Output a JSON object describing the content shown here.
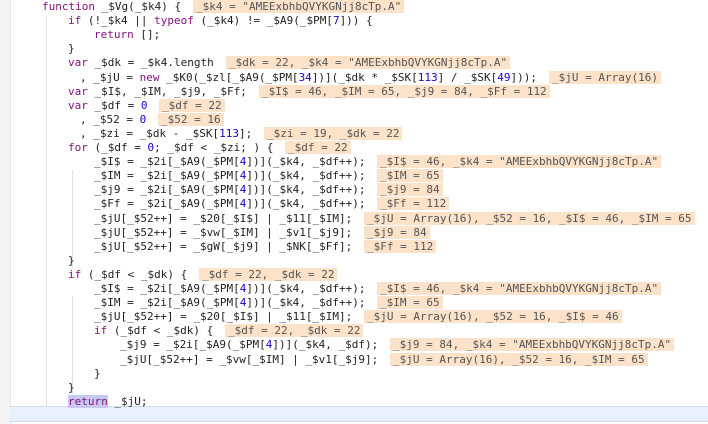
{
  "editor": {
    "lines": [
      {
        "indent": 42,
        "code": [
          {
            "k": "kw",
            "t": "function"
          },
          {
            "k": "id",
            "t": " _$Vg(_$k4) {"
          }
        ],
        "ann": "_$k4 = \"AMEExbhbQVYKGNjj8cTp.A\""
      },
      {
        "indent": 68,
        "code": [
          {
            "k": "kw",
            "t": "if"
          },
          {
            "k": "id",
            "t": " (!_$k4 || "
          },
          {
            "k": "kw",
            "t": "typeof"
          },
          {
            "k": "id",
            "t": " (_$k4) != _$A9(_$PM["
          },
          {
            "k": "num",
            "t": "7"
          },
          {
            "k": "id",
            "t": "])) {"
          }
        ],
        "ann": ""
      },
      {
        "indent": 94,
        "code": [
          {
            "k": "kw",
            "t": "return"
          },
          {
            "k": "id",
            "t": " [];"
          }
        ],
        "ann": ""
      },
      {
        "indent": 68,
        "code": [
          {
            "k": "id",
            "t": "}"
          }
        ],
        "ann": ""
      },
      {
        "indent": 68,
        "code": [
          {
            "k": "kw",
            "t": "var"
          },
          {
            "k": "id",
            "t": " _$dk = _$k4.length"
          }
        ],
        "ann": "_$dk = 22, _$k4 = \"AMEExbhbQVYKGNjj8cTp.A\""
      },
      {
        "indent": 80,
        "code": [
          {
            "k": "id",
            "t": ", _$jU = "
          },
          {
            "k": "kw",
            "t": "new"
          },
          {
            "k": "id",
            "t": " _$K0(_$zl[_$A9(_$PM["
          },
          {
            "k": "num",
            "t": "34"
          },
          {
            "k": "id",
            "t": "])](_$dk * _$SK["
          },
          {
            "k": "num",
            "t": "113"
          },
          {
            "k": "id",
            "t": "] / _$SK["
          },
          {
            "k": "num",
            "t": "49"
          },
          {
            "k": "id",
            "t": "]));"
          }
        ],
        "ann": "_$jU = Array(16)"
      },
      {
        "indent": 68,
        "code": [
          {
            "k": "kw",
            "t": "var"
          },
          {
            "k": "id",
            "t": " _$I$, _$IM, _$j9, _$Ff;"
          }
        ],
        "ann": "_$I$ = 46, _$IM = 65, _$j9 = 84, _$Ff = 112"
      },
      {
        "indent": 68,
        "code": [
          {
            "k": "kw",
            "t": "var"
          },
          {
            "k": "id",
            "t": " _$df = "
          },
          {
            "k": "num",
            "t": "0"
          }
        ],
        "ann": "_$df = 22"
      },
      {
        "indent": 80,
        "code": [
          {
            "k": "id",
            "t": ", _$52 = "
          },
          {
            "k": "num",
            "t": "0"
          }
        ],
        "ann": "_$52 = 16"
      },
      {
        "indent": 80,
        "code": [
          {
            "k": "id",
            "t": ", _$zi = _$dk - _$SK["
          },
          {
            "k": "num",
            "t": "113"
          },
          {
            "k": "id",
            "t": "];"
          }
        ],
        "ann": "_$zi = 19, _$dk = 22"
      },
      {
        "indent": 68,
        "code": [
          {
            "k": "kw",
            "t": "for"
          },
          {
            "k": "id",
            "t": " (_$df = "
          },
          {
            "k": "num",
            "t": "0"
          },
          {
            "k": "id",
            "t": "; _$df < _$zi; ) {"
          }
        ],
        "ann": "_$df = 22"
      },
      {
        "indent": 94,
        "code": [
          {
            "k": "id",
            "t": "_$I$ = _$2i[_$A9(_$PM["
          },
          {
            "k": "num",
            "t": "4"
          },
          {
            "k": "id",
            "t": "])](_$k4, _$df++);"
          }
        ],
        "ann": "_$I$ = 46, _$k4 = \"AMEExbhbQVYKGNjj8cTp.A\""
      },
      {
        "indent": 94,
        "code": [
          {
            "k": "id",
            "t": "_$IM = _$2i[_$A9(_$PM["
          },
          {
            "k": "num",
            "t": "4"
          },
          {
            "k": "id",
            "t": "])](_$k4, _$df++);"
          }
        ],
        "ann": "_$IM = 65"
      },
      {
        "indent": 94,
        "code": [
          {
            "k": "id",
            "t": "_$j9 = _$2i[_$A9(_$PM["
          },
          {
            "k": "num",
            "t": "4"
          },
          {
            "k": "id",
            "t": "])](_$k4, _$df++);"
          }
        ],
        "ann": "_$j9 = 84"
      },
      {
        "indent": 94,
        "code": [
          {
            "k": "id",
            "t": "_$Ff = _$2i[_$A9(_$PM["
          },
          {
            "k": "num",
            "t": "4"
          },
          {
            "k": "id",
            "t": "])](_$k4, _$df++);"
          }
        ],
        "ann": "_$Ff = 112"
      },
      {
        "indent": 94,
        "code": [
          {
            "k": "id",
            "t": "_$jU[_$52++] = _$20[_$I$] | _$11[_$IM];"
          }
        ],
        "ann": "_$jU = Array(16), _$52 = 16, _$I$ = 46, _$IM = 65"
      },
      {
        "indent": 94,
        "code": [
          {
            "k": "id",
            "t": "_$jU[_$52++] = _$vw[_$IM] | _$v1[_$j9];"
          }
        ],
        "ann": "_$j9 = 84"
      },
      {
        "indent": 94,
        "code": [
          {
            "k": "id",
            "t": "_$jU[_$52++] = _$gW[_$j9] | _$NK[_$Ff];"
          }
        ],
        "ann": "_$Ff = 112"
      },
      {
        "indent": 68,
        "code": [
          {
            "k": "id",
            "t": "}"
          }
        ],
        "ann": ""
      },
      {
        "indent": 68,
        "code": [
          {
            "k": "kw",
            "t": "if"
          },
          {
            "k": "id",
            "t": " (_$df < _$dk) {"
          }
        ],
        "ann": "_$df = 22, _$dk = 22"
      },
      {
        "indent": 94,
        "code": [
          {
            "k": "id",
            "t": "_$I$ = _$2i[_$A9(_$PM["
          },
          {
            "k": "num",
            "t": "4"
          },
          {
            "k": "id",
            "t": "])](_$k4, _$df++);"
          }
        ],
        "ann": "_$I$ = 46, _$k4 = \"AMEExbhbQVYKGNjj8cTp.A\""
      },
      {
        "indent": 94,
        "code": [
          {
            "k": "id",
            "t": "_$IM = _$2i[_$A9(_$PM["
          },
          {
            "k": "num",
            "t": "4"
          },
          {
            "k": "id",
            "t": "])](_$k4, _$df++);"
          }
        ],
        "ann": "_$IM = 65"
      },
      {
        "indent": 94,
        "code": [
          {
            "k": "id",
            "t": "_$jU[_$52++] = _$20[_$I$] | _$11[_$IM];"
          }
        ],
        "ann": "_$jU = Array(16), _$52 = 16, _$I$ = 46"
      },
      {
        "indent": 94,
        "code": [
          {
            "k": "kw",
            "t": "if"
          },
          {
            "k": "id",
            "t": " (_$df < _$dk) {"
          }
        ],
        "ann": "_$df = 22, _$dk = 22"
      },
      {
        "indent": 120,
        "code": [
          {
            "k": "id",
            "t": "_$j9 = _$2i[_$A9(_$PM["
          },
          {
            "k": "num",
            "t": "4"
          },
          {
            "k": "id",
            "t": "])](_$k4, _$df);"
          }
        ],
        "ann": "_$j9 = 84, _$k4 = \"AMEExbhbQVYKGNjj8cTp.A\""
      },
      {
        "indent": 120,
        "code": [
          {
            "k": "id",
            "t": "_$jU[_$52++] = _$vw[_$IM] | _$v1[_$j9];"
          }
        ],
        "ann": "_$jU = Array(16), _$52 = 16, _$IM = 65"
      },
      {
        "indent": 94,
        "code": [
          {
            "k": "id",
            "t": "}"
          }
        ],
        "ann": ""
      },
      {
        "indent": 68,
        "code": [
          {
            "k": "id",
            "t": "}"
          }
        ],
        "ann": ""
      },
      {
        "indent": 68,
        "code": [
          {
            "k": "kw",
            "t": "return"
          },
          {
            "k": "id",
            "t": " _$jU;"
          }
        ],
        "ann": "",
        "selected": "return"
      }
    ]
  },
  "colors": {
    "keyword": "#881280",
    "number": "#1c00cf",
    "annotation_bg": "#fbe2c9",
    "current_line": "#e8f0fe",
    "selection": "#c8c8f0"
  }
}
